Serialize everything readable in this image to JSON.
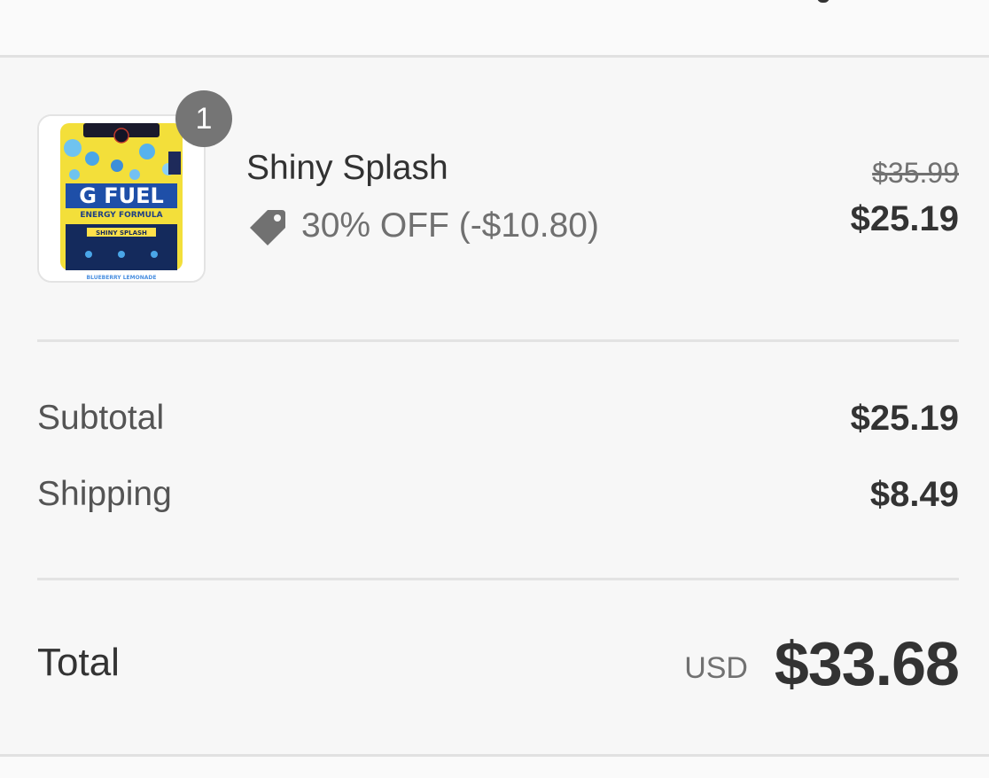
{
  "line_item": {
    "quantity": "1",
    "name": "Shiny Splash",
    "discount": "30% OFF (-$10.80)",
    "original_price": "$35.99",
    "final_price": "$25.19",
    "image_icon": "product-tub-icon",
    "discount_icon": "price-tag-icon",
    "image_text": {
      "brand": "G FUEL",
      "tagline": "ENERGY FORMULA",
      "flavor": "SHINY SPLASH",
      "flavor_strip": "BLUEBERRY LEMONADE"
    }
  },
  "summary": {
    "subtotal_label": "Subtotal",
    "subtotal_value": "$25.19",
    "shipping_label": "Shipping",
    "shipping_value": "$8.49"
  },
  "total": {
    "label": "Total",
    "currency": "USD",
    "value": "$33.68"
  },
  "colors": {
    "background": "#f7f7f7",
    "badge": "#757575",
    "text_primary": "#333333",
    "text_secondary": "#717171",
    "divider": "#e3e3e3"
  }
}
